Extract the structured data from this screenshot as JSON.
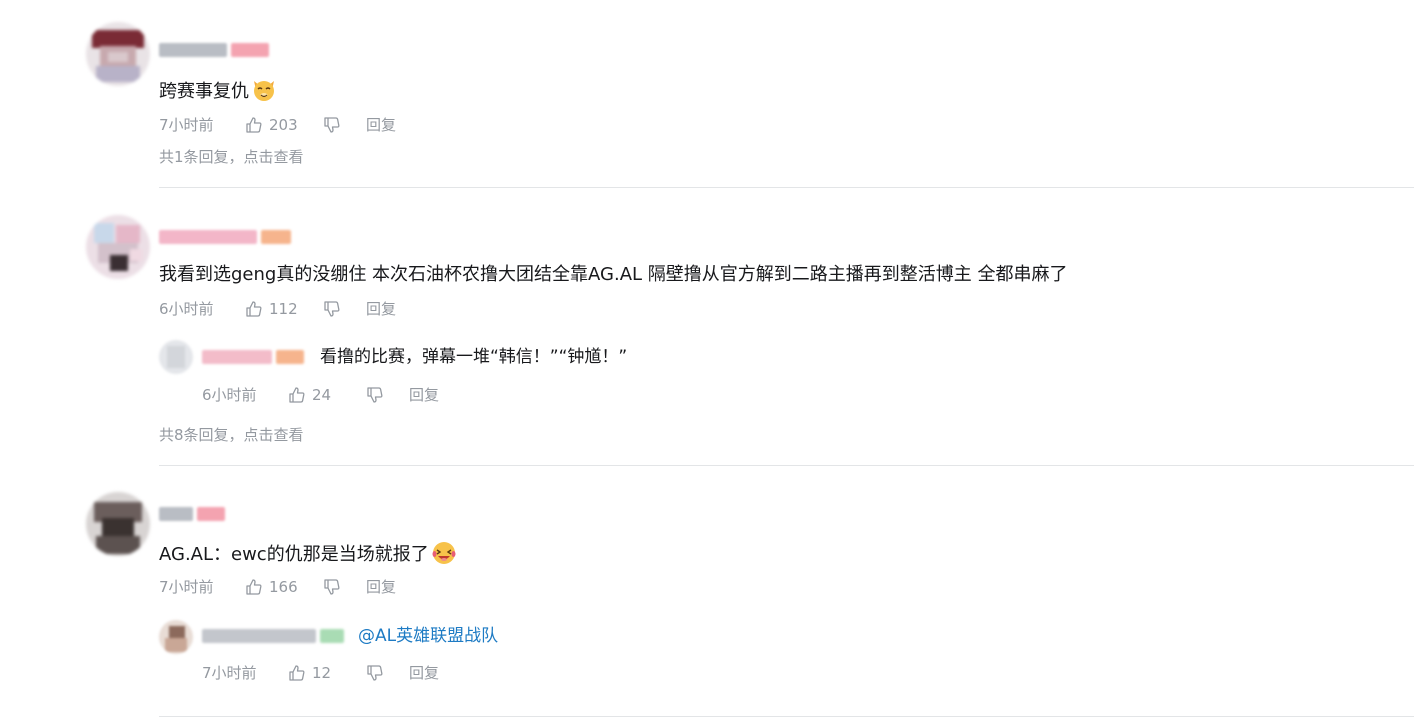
{
  "comments": [
    {
      "text": "跨赛事复仇",
      "emoji": "cat-face-emoji",
      "time": "7小时前",
      "likes": "203",
      "reply_label": "回复",
      "view_replies": "共1条回复，点击查看"
    },
    {
      "text": "我看到选geng真的没绷住 本次石油杯农撸大团结全靠AG.AL 隔壁撸从官方解到二路主播再到整活博主 全都串麻了",
      "time": "6小时前",
      "likes": "112",
      "reply_label": "回复",
      "sub_reply": {
        "text": "看撸的比赛，弹幕一堆“韩信！”“钟馗！”",
        "time": "6小时前",
        "likes": "24",
        "reply_label": "回复"
      },
      "view_replies": "共8条回复，点击查看"
    },
    {
      "text": "AG.AL：ewc的仇那是当场就报了",
      "emoji": "laughing-tears-emoji",
      "time": "7小时前",
      "likes": "166",
      "reply_label": "回复",
      "sub_reply": {
        "mention": "@AL英雄联盟战队",
        "time": "7小时前",
        "likes": "12",
        "reply_label": "回复"
      }
    }
  ],
  "colors": {
    "text": "#18191c",
    "meta": "#9499a0",
    "mention": "#1e7bc4",
    "divider": "#e3e5e7"
  }
}
